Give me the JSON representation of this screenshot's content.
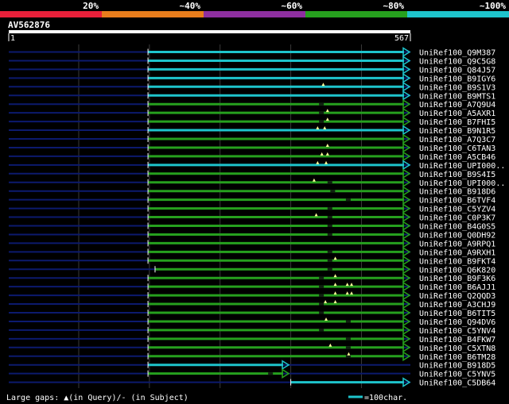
{
  "identity_scale": {
    "labels": [
      "20%",
      "~40%",
      "~60%",
      "~80%",
      "~100%"
    ],
    "colors": [
      "#e8203a",
      "#e87d1c",
      "#8e2fa0",
      "#26a01e",
      "#1ec4cc"
    ]
  },
  "query": {
    "id": "AV562876",
    "start_label": "1",
    "end_label": "567",
    "length": 567
  },
  "colors": {
    "background": "#000000",
    "query_bar": "#ffffff",
    "unaligned": "#0c1a6e",
    "gridline": "#3a3a3a",
    "gap_marker": "#ffff99",
    "hit_label": "#ffffff"
  },
  "hits": [
    {
      "id": "UniRef100_Q9M387",
      "identity": "~100%",
      "start": 198,
      "end": 567,
      "gaps_query": [],
      "breaks": []
    },
    {
      "id": "UniRef100_Q9C5G8",
      "identity": "~100%",
      "start": 198,
      "end": 567,
      "gaps_query": [],
      "breaks": []
    },
    {
      "id": "UniRef100_Q84J57",
      "identity": "~100%",
      "start": 198,
      "end": 567,
      "gaps_query": [],
      "breaks": []
    },
    {
      "id": "UniRef100_B9IGY6",
      "identity": "~100%",
      "start": 198,
      "end": 567,
      "gaps_query": [],
      "breaks": []
    },
    {
      "id": "UniRef100_B9S1V3",
      "identity": "~100%",
      "start": 198,
      "end": 567,
      "gaps_query": [
        446
      ],
      "breaks": []
    },
    {
      "id": "UniRef100_B9MTS1",
      "identity": "~100%",
      "start": 198,
      "end": 567,
      "gaps_query": [],
      "breaks": []
    },
    {
      "id": "UniRef100_A7Q9U4",
      "identity": "~80%",
      "start": 198,
      "end": 567,
      "gaps_query": [],
      "breaks": [
        440
      ]
    },
    {
      "id": "UniRef100_A5AXR1",
      "identity": "~80%",
      "start": 198,
      "end": 567,
      "gaps_query": [
        452
      ],
      "breaks": [
        440
      ]
    },
    {
      "id": "UniRef100_B7FHI5",
      "identity": "~80%",
      "start": 198,
      "end": 567,
      "gaps_query": [
        452
      ],
      "breaks": [
        440
      ]
    },
    {
      "id": "UniRef100_B9N1R5",
      "identity": "~100%",
      "start": 198,
      "end": 567,
      "gaps_query": [
        438,
        448
      ],
      "breaks": []
    },
    {
      "id": "UniRef100_A7Q3C7",
      "identity": "~80%",
      "start": 198,
      "end": 567,
      "gaps_query": [],
      "breaks": []
    },
    {
      "id": "UniRef100_C6TAN3",
      "identity": "~80%",
      "start": 198,
      "end": 567,
      "gaps_query": [
        452
      ],
      "breaks": []
    },
    {
      "id": "UniRef100_A5CB46",
      "identity": "~80%",
      "start": 198,
      "end": 567,
      "gaps_query": [
        444,
        452
      ],
      "breaks": []
    },
    {
      "id": "UniRef100_UPI000..",
      "identity": "~100%",
      "start": 198,
      "end": 567,
      "gaps_query": [
        438,
        450
      ],
      "breaks": []
    },
    {
      "id": "UniRef100_B9S4I5",
      "identity": "~80%",
      "start": 198,
      "end": 567,
      "gaps_query": [],
      "breaks": []
    },
    {
      "id": "UniRef100_UPI000..",
      "identity": "~80%",
      "start": 198,
      "end": 567,
      "gaps_query": [
        433
      ],
      "breaks": [
        452
      ]
    },
    {
      "id": "UniRef100_B918D6",
      "identity": "~80%",
      "start": 198,
      "end": 567,
      "gaps_query": [],
      "breaks": [
        456
      ]
    },
    {
      "id": "UniRef100_B6TVF4",
      "identity": "~80%",
      "start": 198,
      "end": 567,
      "gaps_query": [],
      "breaks": [
        478
      ]
    },
    {
      "id": "UniRef100_C5YZV4",
      "identity": "~80%",
      "start": 198,
      "end": 567,
      "gaps_query": [],
      "breaks": [
        452
      ]
    },
    {
      "id": "UniRef100_C0P3K7",
      "identity": "~80%",
      "start": 198,
      "end": 567,
      "gaps_query": [
        436
      ],
      "breaks": [
        452
      ]
    },
    {
      "id": "UniRef100_B4G0S5",
      "identity": "~80%",
      "start": 198,
      "end": 567,
      "gaps_query": [],
      "breaks": [
        452
      ]
    },
    {
      "id": "UniRef100_Q0DH92",
      "identity": "~80%",
      "start": 198,
      "end": 567,
      "gaps_query": [],
      "breaks": [
        452
      ]
    },
    {
      "id": "UniRef100_A9RPQ1",
      "identity": "~80%",
      "start": 198,
      "end": 567,
      "gaps_query": [],
      "breaks": []
    },
    {
      "id": "UniRef100_A9RXH1",
      "identity": "~80%",
      "start": 198,
      "end": 567,
      "gaps_query": [],
      "breaks": [
        452
      ]
    },
    {
      "id": "UniRef100_B9FKT4",
      "identity": "~80%",
      "start": 198,
      "end": 567,
      "gaps_query": [
        463
      ],
      "breaks": [
        452
      ]
    },
    {
      "id": "UniRef100_Q6K820",
      "identity": "~80%",
      "start": 208,
      "end": 567,
      "gaps_query": [],
      "breaks": [
        452
      ]
    },
    {
      "id": "UniRef100_B9F3K6",
      "identity": "~80%",
      "start": 198,
      "end": 567,
      "gaps_query": [
        463
      ],
      "breaks": [
        440
      ]
    },
    {
      "id": "UniRef100_B6AJJ1",
      "identity": "~80%",
      "start": 198,
      "end": 567,
      "gaps_query": [
        463,
        480,
        486
      ],
      "breaks": [
        440
      ]
    },
    {
      "id": "UniRef100_Q2QQD3",
      "identity": "~80%",
      "start": 198,
      "end": 567,
      "gaps_query": [
        463,
        480,
        486
      ],
      "breaks": [
        440
      ]
    },
    {
      "id": "UniRef100_A3CHJ9",
      "identity": "~80%",
      "start": 198,
      "end": 567,
      "gaps_query": [
        449,
        463
      ],
      "breaks": [
        440
      ]
    },
    {
      "id": "UniRef100_B6TIT5",
      "identity": "~80%",
      "start": 198,
      "end": 567,
      "gaps_query": [],
      "breaks": [
        440
      ]
    },
    {
      "id": "UniRef100_Q94DV6",
      "identity": "~80%",
      "start": 198,
      "end": 567,
      "gaps_query": [
        450
      ],
      "breaks": [
        478
      ]
    },
    {
      "id": "UniRef100_C5YNV4",
      "identity": "~80%",
      "start": 198,
      "end": 567,
      "gaps_query": [],
      "breaks": [
        440
      ]
    },
    {
      "id": "UniRef100_B4FKW7",
      "identity": "~80%",
      "start": 198,
      "end": 567,
      "gaps_query": [],
      "breaks": [
        478
      ]
    },
    {
      "id": "UniRef100_C5XTN8",
      "identity": "~80%",
      "start": 198,
      "end": 567,
      "gaps_query": [
        456
      ],
      "breaks": [
        478
      ]
    },
    {
      "id": "UniRef100_B6TM28",
      "identity": "~80%",
      "start": 198,
      "end": 567,
      "gaps_query": [
        482
      ],
      "breaks": [
        478
      ]
    },
    {
      "id": "UniRef100_B918D5",
      "identity": "~100%",
      "start": 198,
      "end": 396,
      "gaps_query": [],
      "breaks": []
    },
    {
      "id": "UniRef100_C5YNV5",
      "identity": "~80%",
      "start": 198,
      "end": 396,
      "gaps_query": [],
      "breaks": [
        368
      ]
    },
    {
      "id": "UniRef100_C5DB64",
      "identity": "~100%",
      "start": 400,
      "end": 567,
      "gaps_query": [],
      "breaks": []
    }
  ],
  "footer": {
    "legend_text": "Large gaps: ▲(in Query)/- (in Subject)",
    "scale_label": "=100char."
  }
}
